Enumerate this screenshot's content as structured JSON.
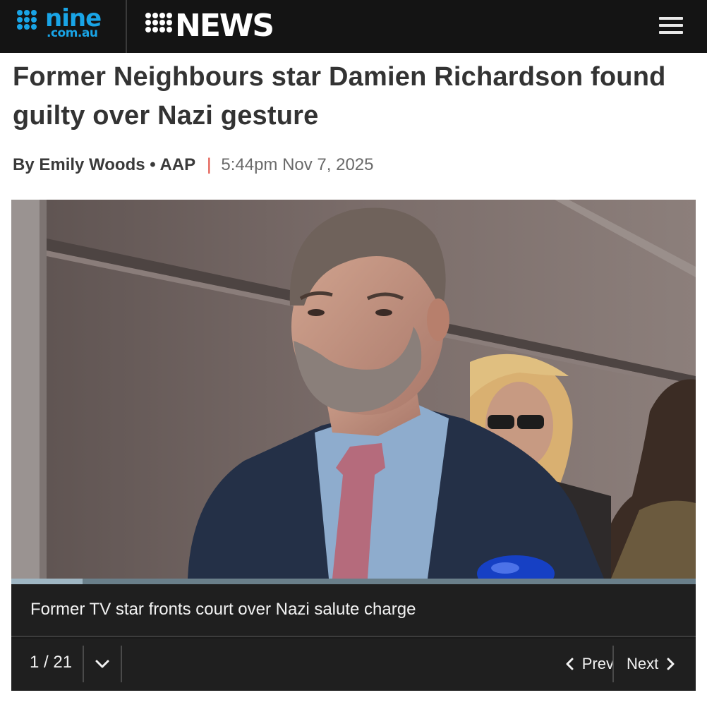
{
  "header": {
    "nine_logo": {
      "word": "nine",
      "domain": ".com.au"
    },
    "news_logo": {
      "word": "NEWS"
    },
    "menu_icon": "hamburger-menu-icon",
    "brand_blue": "#19a4e6",
    "bar_color": "#141414"
  },
  "article": {
    "headline": "Former Neighbours star Damien Richardson found guilty over Nazi gesture",
    "author": "By Emily Woods • AAP",
    "separator": "|",
    "timestamp": "5:44pm Nov 7, 2025",
    "separator_color": "#e0483c"
  },
  "gallery": {
    "caption": "Former TV star fronts court over Nazi salute charge",
    "counter": "1 / 21",
    "current": 1,
    "total": 21,
    "progress_fraction": 0.104,
    "prev_label": "Prev",
    "next_label": "Next",
    "icons": {
      "dropdown": "chevron-down-icon",
      "prev": "chevron-left-icon",
      "next": "chevron-right-icon"
    }
  }
}
